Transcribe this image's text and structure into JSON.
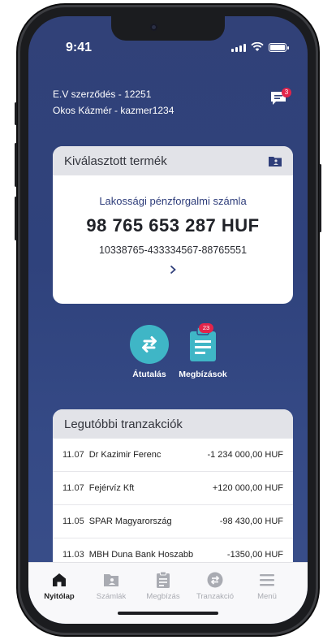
{
  "status": {
    "time": "9:41"
  },
  "account": {
    "contract": "E.V szerződés - 12251",
    "user": "Okos Kázmér - kazmer1234",
    "notification_count": "3"
  },
  "selected_product": {
    "header": "Kiválasztott termék",
    "name": "Lakossági pénzforgalmi számla",
    "amount": "98 765 653 287 HUF",
    "account_number": "10338765-433334567-88765551"
  },
  "actions": [
    {
      "label": "Átutalás",
      "icon": "transfer-icon"
    },
    {
      "label": "Megbízások",
      "icon": "clipboard-icon",
      "badge": "23"
    }
  ],
  "transactions": {
    "header": "Legutóbbi tranzakciók",
    "rows": [
      {
        "date": "11.07",
        "name": "Dr Kazimir Ferenc",
        "amount": "-1 234 000,00 HUF"
      },
      {
        "date": "11.07",
        "name": "Fejérvíz Kft",
        "amount": "+120 000,00 HUF"
      },
      {
        "date": "11.05",
        "name": "SPAR Magyarország",
        "amount": "-98 430,00 HUF"
      },
      {
        "date": "11.03",
        "name": "MBH Duna Bank Hoszabb",
        "amount": "-1350,00 HUF"
      }
    ]
  },
  "tabbar": [
    {
      "label": "Nyitólap",
      "icon": "home-icon",
      "active": true
    },
    {
      "label": "Számlák",
      "icon": "folder-icon",
      "active": false
    },
    {
      "label": "Megbízás",
      "icon": "clipboard-icon",
      "active": false
    },
    {
      "label": "Tranzakció",
      "icon": "transaction-icon",
      "active": false
    },
    {
      "label": "Menü",
      "icon": "hamburger-icon",
      "active": false
    }
  ],
  "colors": {
    "background": "#314178",
    "accent": "#3fb6c6",
    "badge": "#e3244a"
  }
}
